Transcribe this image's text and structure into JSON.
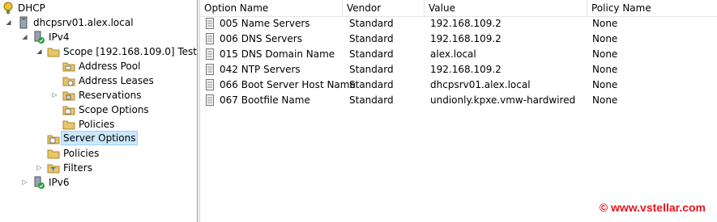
{
  "tree": {
    "dhcp": "DHCP",
    "server": "dhcpsrv01.alex.local",
    "ipv4": "IPv4",
    "scope": "Scope [192.168.109.0] Test",
    "address_pool": "Address Pool",
    "address_leases": "Address Leases",
    "reservations": "Reservations",
    "scope_options": "Scope Options",
    "scope_policies": "Policies",
    "server_options": "Server Options",
    "policies": "Policies",
    "filters": "Filters",
    "ipv6": "IPv6"
  },
  "list": {
    "columns": [
      "Option Name",
      "Vendor",
      "Value",
      "Policy Name"
    ],
    "rows": [
      [
        "005 Name Servers",
        "Standard",
        "192.168.109.2",
        "None"
      ],
      [
        "006 DNS Servers",
        "Standard",
        "192.168.109.2",
        "None"
      ],
      [
        "015 DNS Domain Name",
        "Standard",
        "alex.local",
        "None"
      ],
      [
        "042 NTP Servers",
        "Standard",
        "192.168.109.2",
        "None"
      ],
      [
        "066 Boot Server Host Name",
        "Standard",
        "dhcpsrv01.alex.local",
        "None"
      ],
      [
        "067 Bootfile Name",
        "Standard",
        "undionly.kpxe.vmw-hardwired",
        "None"
      ]
    ]
  },
  "watermark": "© www.vstellar.com",
  "colors": {
    "selection": "#cce8ff",
    "watermark": "#e8141e",
    "folder": "#e8c46a"
  }
}
